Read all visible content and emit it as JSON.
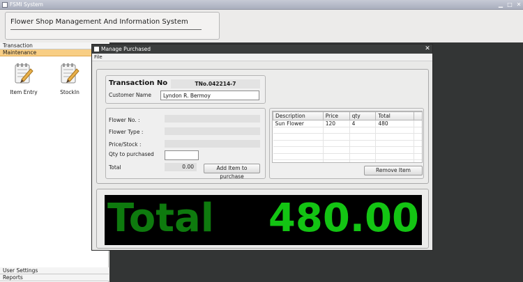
{
  "app": {
    "window_title": "FSMI System",
    "header_title": "Flower Shop Management And Information System"
  },
  "nav": {
    "transaction": "Transaction",
    "maintenance": "Maintenance",
    "tiles": [
      {
        "label": "Item Entry",
        "icon": "notepad-pencil-icon"
      },
      {
        "label": "StockIn",
        "icon": "notepad-pencil-icon"
      }
    ],
    "user_settings": "User Settings",
    "reports": "Reports"
  },
  "dialog": {
    "title": "Manage Purchased",
    "menu_file": "File",
    "transaction_label": "Transaction No",
    "transaction_value": "TNo.042214-7",
    "customer_label": "Customer Name",
    "customer_value": "Lyndon R. Bermoy",
    "flower_no_label": "Flower No. :",
    "flower_type_label": "Flower Type :",
    "price_stock_label": "Price/Stock :",
    "qty_label": "Qty to purchased",
    "qty_value": "",
    "total_label": "Total",
    "total_value": "0.00",
    "add_button": "Add Item to purchase",
    "remove_button": "Remove Item",
    "table": {
      "columns": [
        "Description",
        "Price",
        "qty",
        "Total"
      ],
      "rows": [
        [
          "Sun Flower",
          "120",
          "4",
          "480"
        ]
      ]
    },
    "total_display": {
      "label": "Total",
      "value": "480.00",
      "label_color": "#0e7a0e",
      "value_color": "#13c413"
    }
  },
  "colors": {
    "titlebar": "#b3b7c4",
    "maintenance_highlight": "#f8ce84",
    "workspace": "#333535",
    "dialog_titlebar": "#3b3d3d"
  }
}
